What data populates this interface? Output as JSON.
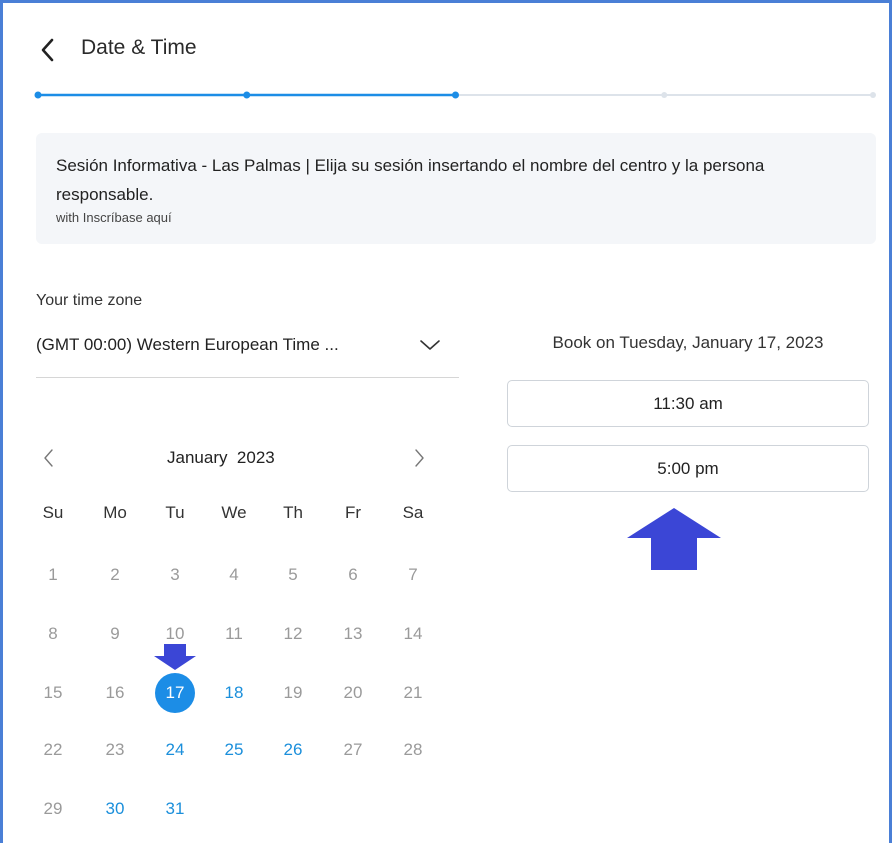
{
  "header": {
    "title": "Date & Time",
    "back_icon": "chevron-left-icon"
  },
  "stepper": {
    "total_steps": 5,
    "current_step": 3,
    "active_color": "#1c8de6",
    "inactive_color": "#dde3ea"
  },
  "session": {
    "title": "Sesión Informativa - Las Palmas | Elija su sesión insertando el nombre del centro y la persona responsable.",
    "host": "with Inscríbase aquí"
  },
  "timezone": {
    "label": "Your time zone",
    "value": "(GMT 00:00) Western European Time ...",
    "chevron_icon": "chevron-down-icon"
  },
  "calendar": {
    "month_label": "January  2023",
    "prev_icon": "chevron-left-icon",
    "next_icon": "chevron-right-icon",
    "weekdays": [
      "Su",
      "Mo",
      "Tu",
      "We",
      "Th",
      "Fr",
      "Sa"
    ],
    "first_weekday_index": 0,
    "days_in_month": 31,
    "available_days": [
      18,
      24,
      25,
      26,
      30,
      31
    ],
    "selected_day": 17,
    "available_color": "#1b8fdb",
    "selected_color": "#1c8de6"
  },
  "booking": {
    "label": "Book on Tuesday, January 17, 2023",
    "slots": [
      {
        "label": "11:30 am"
      },
      {
        "label": "5:00 pm"
      }
    ]
  },
  "annotations": {
    "arrow_color": "#3b46d6"
  }
}
